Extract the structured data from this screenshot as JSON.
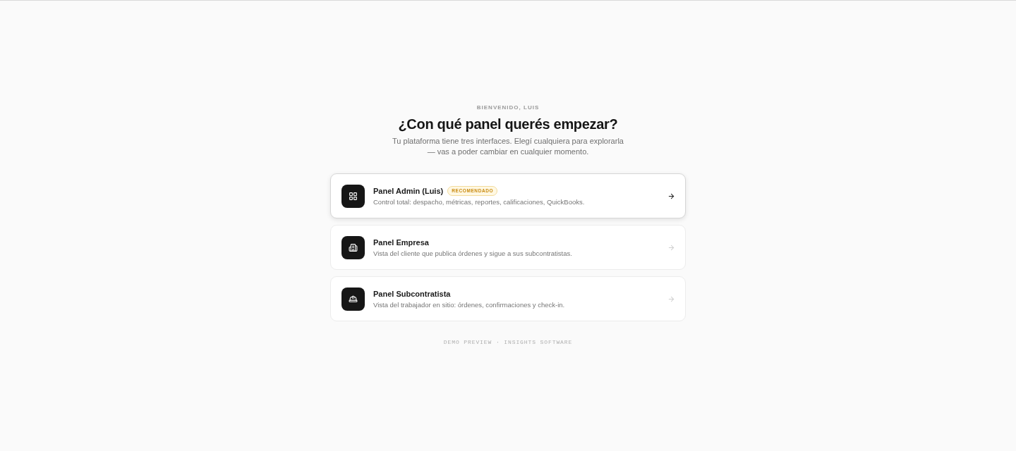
{
  "header": {
    "eyebrow": "BIENVENIDO, LUIS",
    "title": "¿Con qué panel querés empezar?",
    "subtitle": "Tu plataforma tiene tres interfaces. Elegí cualquiera para explorarla — vas a poder cambiar en cualquier momento."
  },
  "panels": [
    {
      "kind": "admin",
      "title": "Panel Admin (Luis)",
      "badge": "RECOMENDADO",
      "description": "Control total: despacho, métricas, reportes, calificaciones, QuickBooks.",
      "selected": true
    },
    {
      "kind": "company",
      "title": "Panel Empresa",
      "description": "Vista del cliente que publica órdenes y sigue a sus subcontratistas.",
      "selected": false
    },
    {
      "kind": "worker",
      "title": "Panel Subcontratista",
      "description": "Vista del trabajador en sitio: órdenes, confirmaciones y check-in.",
      "selected": false
    }
  ],
  "footer": "DEMO PREVIEW · INSIGHTS SOFTWARE"
}
